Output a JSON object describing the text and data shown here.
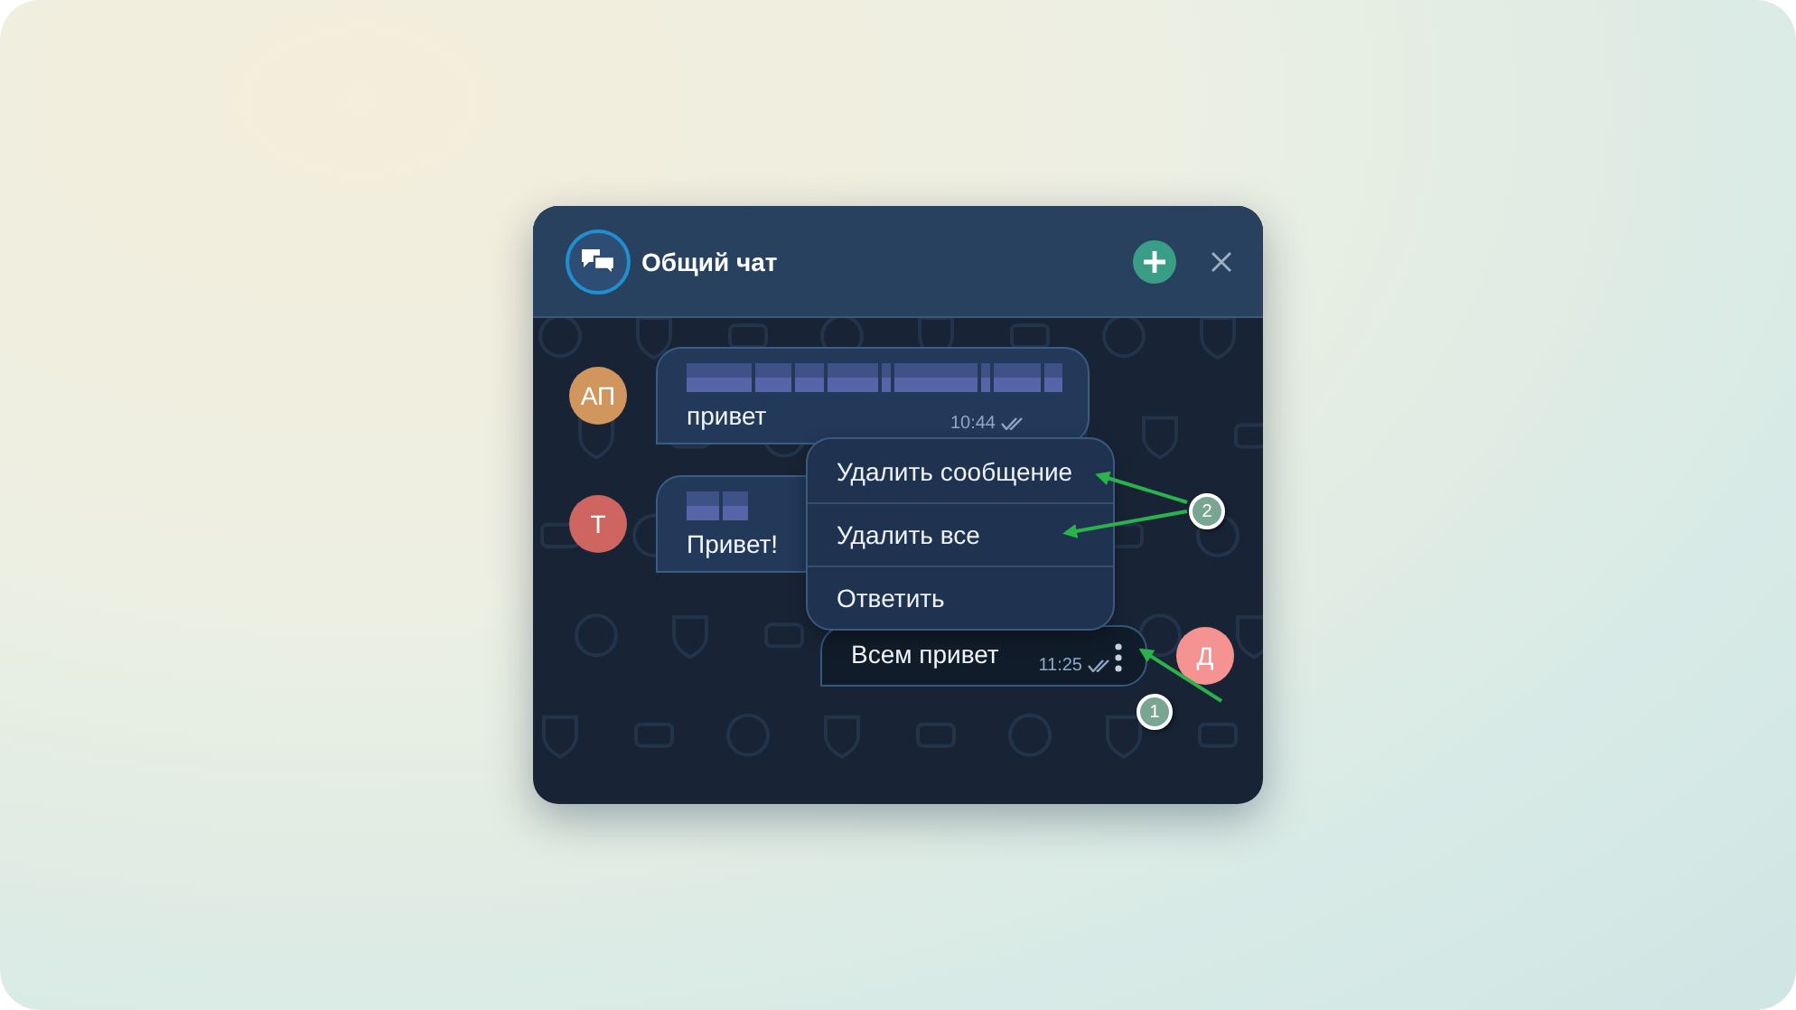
{
  "window": {
    "title": "Общий чат"
  },
  "messages": [
    {
      "kind": "incoming",
      "avatar": "АП",
      "color": "#d0965e",
      "text": "привет",
      "time": "10:44",
      "read": true
    },
    {
      "kind": "incoming",
      "avatar": "Т",
      "color": "#cf6561",
      "text": "Привет!"
    },
    {
      "kind": "outgoing",
      "avatar": "Д",
      "color": "#f59393",
      "text": "Всем привет",
      "time": "11:25",
      "read": true
    }
  ],
  "context_menu": {
    "items": [
      "Удалить сообщение",
      "Удалить все",
      "Ответить"
    ]
  },
  "callouts": [
    {
      "label": "1"
    },
    {
      "label": "2"
    }
  ]
}
